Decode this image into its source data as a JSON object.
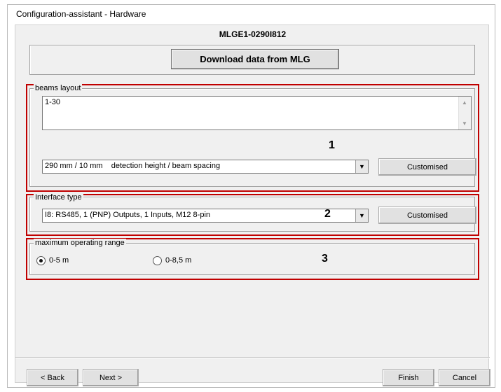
{
  "window": {
    "title": "Configuration-assistant - Hardware"
  },
  "device": {
    "name": "MLGE1-0290I812"
  },
  "download_button": {
    "label": "Download data from MLG"
  },
  "beams_layout": {
    "group_label": "beams layout",
    "text": "1-30",
    "marker": "1",
    "combo_value": "290 mm / 10 mm    detection height / beam spacing",
    "customised_label": "Customised"
  },
  "interface_type": {
    "group_label": "Interface type",
    "marker": "2",
    "combo_value": "I8: RS485, 1 (PNP) Outputs, 1 Inputs, M12 8-pin",
    "customised_label": "Customised"
  },
  "operating_range": {
    "group_label": "maximum operating range",
    "marker": "3",
    "options": [
      {
        "label": "0-5 m",
        "selected": true
      },
      {
        "label": "0-8,5 m",
        "selected": false
      }
    ]
  },
  "footer": {
    "back_label": "< Back",
    "next_label": "Next >",
    "finish_label": "Finish",
    "cancel_label": "Cancel"
  },
  "colors": {
    "highlight": "#c00000",
    "dialog_bg": "#f0f0f0"
  },
  "icons": {
    "combo_arrow": "chevron-down-icon",
    "scroll_up": "scroll-up-icon",
    "scroll_down": "scroll-down-icon",
    "radio": "radio-icon"
  }
}
